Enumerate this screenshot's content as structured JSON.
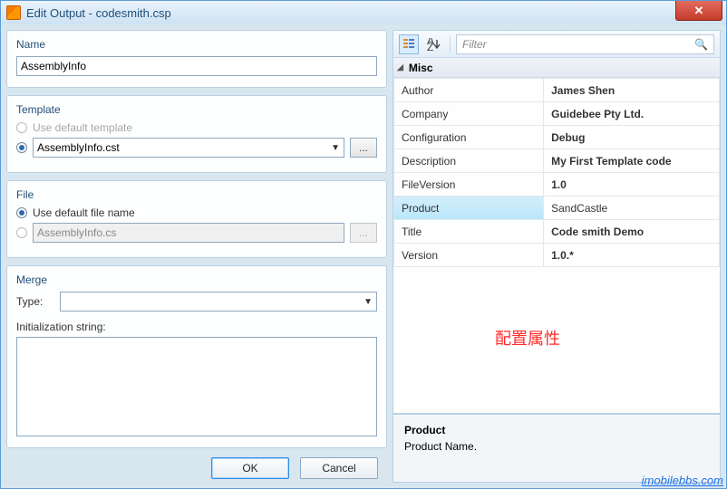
{
  "window": {
    "title": "Edit Output - codesmith.csp"
  },
  "name": {
    "label": "Name",
    "value": "AssemblyInfo"
  },
  "template": {
    "label": "Template",
    "useDefaultLabel": "Use default template",
    "value": "AssemblyInfo.cst",
    "browse": "..."
  },
  "file": {
    "label": "File",
    "useDefaultLabel": "Use default file name",
    "value": "AssemblyInfo.cs",
    "browse": "..."
  },
  "merge": {
    "label": "Merge",
    "typeLabel": "Type:",
    "initLabel": "Initialization string:"
  },
  "buttons": {
    "ok": "OK",
    "cancel": "Cancel"
  },
  "toolbar": {
    "filterPlaceholder": "Filter"
  },
  "category": {
    "name": "Misc"
  },
  "props": [
    {
      "k": "Author",
      "v": "James Shen"
    },
    {
      "k": "Company",
      "v": "Guidebee Pty Ltd."
    },
    {
      "k": "Configuration",
      "v": "Debug"
    },
    {
      "k": "Description",
      "v": "My First Template code"
    },
    {
      "k": "FileVersion",
      "v": "1.0"
    },
    {
      "k": "Product",
      "v": "SandCastle"
    },
    {
      "k": "Title",
      "v": "Code smith Demo"
    },
    {
      "k": "Version",
      "v": "1.0.*"
    }
  ],
  "selectedIndex": 5,
  "help": {
    "title": "Product",
    "desc": "Product Name."
  },
  "annotation": "配置属性",
  "watermark": "imobilebbs.com"
}
